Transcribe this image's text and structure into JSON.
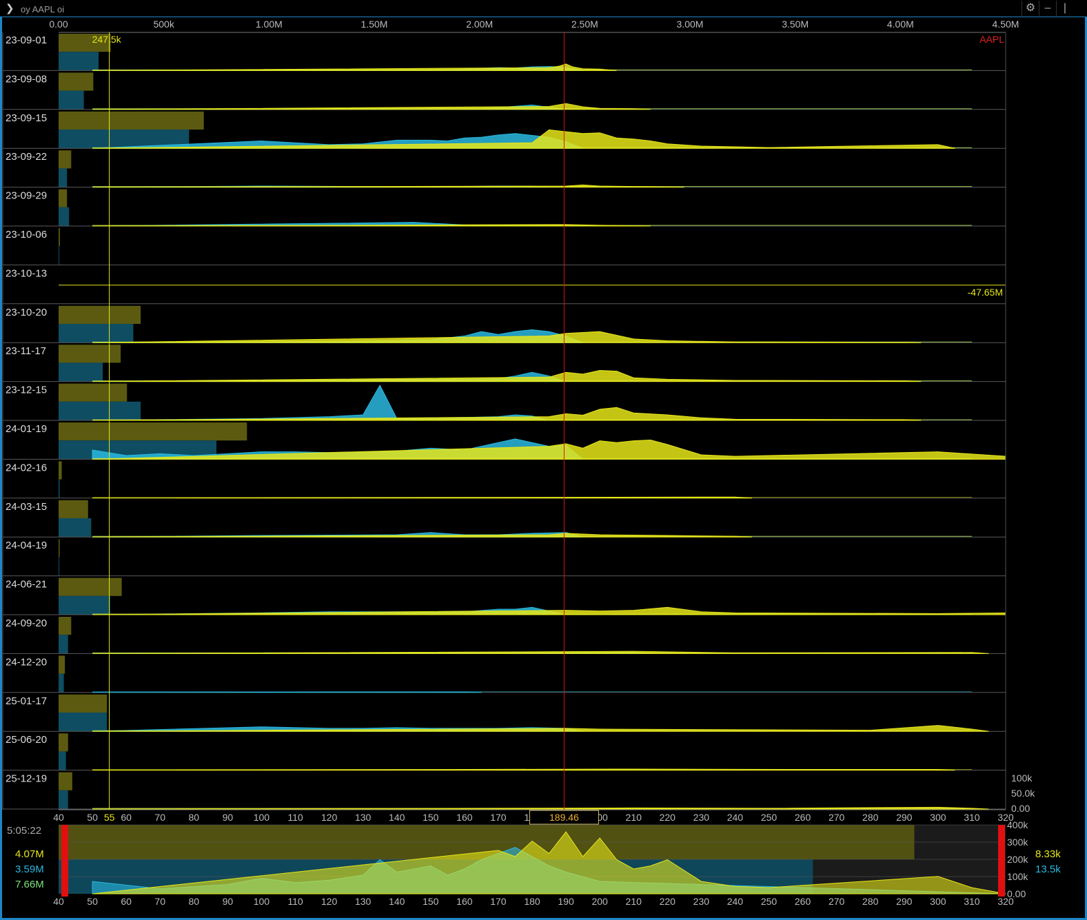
{
  "command": {
    "text": "oy AAPL oi"
  },
  "window_buttons": {
    "settings_icon": "gear-icon",
    "minimize": "–",
    "maximize": "|"
  },
  "colors": {
    "call": "#e6e619",
    "put": "#2ab9e0",
    "call_bar": "#5b5a10",
    "put_bar": "#0e4d62",
    "price_line": "#cc1a1a",
    "frame": "#1f86c7"
  },
  "chart_data": {
    "type": "area",
    "symbol": "AAPL",
    "title": "",
    "top_axis": {
      "ticks": [
        "0.00",
        "500k",
        "1.00M",
        "1.50M",
        "2.00M",
        "2.50M",
        "3.00M",
        "3.50M",
        "4.00M",
        "4.50M"
      ],
      "range": [
        0,
        4500000
      ]
    },
    "strike_axis": {
      "ticks": [
        40,
        50,
        60,
        70,
        80,
        90,
        100,
        110,
        120,
        130,
        140,
        150,
        160,
        170,
        180,
        190,
        200,
        210,
        220,
        230,
        240,
        250,
        260,
        270,
        280,
        290,
        300,
        310,
        320
      ],
      "range": [
        40,
        320
      ]
    },
    "right_axis": {
      "ticks": [
        "100k",
        "50.0k",
        "0.00"
      ]
    },
    "marker_strike": 55,
    "marker_value_label": "247.5k",
    "current_price": "189.46",
    "divider_label": "-47.65M",
    "expiries": [
      {
        "label": "23-09-01",
        "call_total": 247500,
        "put_total": 190000,
        "calls": [
          [
            185,
            0.08
          ],
          [
            188,
            0.12
          ],
          [
            190,
            0.18
          ],
          [
            192,
            0.1
          ],
          [
            195,
            0.05
          ],
          [
            200,
            0.04
          ]
        ],
        "puts": [
          [
            155,
            0.02
          ],
          [
            160,
            0.04
          ],
          [
            165,
            0.06
          ],
          [
            170,
            0.08
          ],
          [
            175,
            0.07
          ],
          [
            180,
            0.1
          ],
          [
            185,
            0.11
          ],
          [
            190,
            0.09
          ]
        ]
      },
      {
        "label": "23-09-08",
        "call_total": 165000,
        "put_total": 120000,
        "calls": [
          [
            185,
            0.08
          ],
          [
            190,
            0.16
          ],
          [
            195,
            0.07
          ],
          [
            200,
            0.03
          ],
          [
            210,
            0.02
          ]
        ],
        "puts": [
          [
            165,
            0.03
          ],
          [
            170,
            0.05
          ],
          [
            180,
            0.12
          ],
          [
            185,
            0.06
          ]
        ]
      },
      {
        "label": "23-09-15",
        "call_total": 690000,
        "put_total": 620000,
        "calls": [
          [
            180,
            0.15
          ],
          [
            185,
            0.5
          ],
          [
            190,
            0.45
          ],
          [
            195,
            0.4
          ],
          [
            200,
            0.42
          ],
          [
            205,
            0.28
          ],
          [
            210,
            0.25
          ],
          [
            215,
            0.2
          ],
          [
            220,
            0.12
          ],
          [
            230,
            0.06
          ],
          [
            240,
            0.04
          ],
          [
            250,
            0.02
          ],
          [
            300,
            0.1
          ]
        ],
        "puts": [
          [
            100,
            0.2
          ],
          [
            120,
            0.1
          ],
          [
            130,
            0.12
          ],
          [
            140,
            0.22
          ],
          [
            150,
            0.22
          ],
          [
            155,
            0.2
          ],
          [
            160,
            0.28
          ],
          [
            165,
            0.3
          ],
          [
            170,
            0.36
          ],
          [
            175,
            0.4
          ],
          [
            180,
            0.35
          ],
          [
            185,
            0.3
          ],
          [
            190,
            0.18
          ]
        ]
      },
      {
        "label": "23-09-22",
        "call_total": 60000,
        "put_total": 40000,
        "calls": [
          [
            190,
            0.03
          ],
          [
            195,
            0.06
          ],
          [
            200,
            0.03
          ],
          [
            220,
            0.01
          ]
        ],
        "puts": [
          [
            100,
            0.03
          ],
          [
            150,
            0.01
          ],
          [
            170,
            0.03
          ],
          [
            180,
            0.03
          ]
        ]
      },
      {
        "label": "23-09-29",
        "call_total": 40000,
        "put_total": 50000,
        "calls": [
          [
            190,
            0.04
          ],
          [
            195,
            0.03
          ],
          [
            200,
            0.02
          ],
          [
            210,
            0.01
          ]
        ],
        "puts": [
          [
            145,
            0.1
          ],
          [
            160,
            0.03
          ],
          [
            170,
            0.03
          ],
          [
            180,
            0.02
          ]
        ]
      },
      {
        "label": "23-10-06",
        "call_total": 6000,
        "put_total": 3000,
        "calls": [],
        "puts": []
      },
      {
        "label": "23-10-13",
        "call_total": 0,
        "put_total": 0,
        "calls": [],
        "puts": []
      },
      {
        "label": "23-10-20",
        "call_total": 390000,
        "put_total": 355000,
        "calls": [
          [
            185,
            0.18
          ],
          [
            190,
            0.25
          ],
          [
            200,
            0.3
          ],
          [
            210,
            0.1
          ],
          [
            220,
            0.05
          ],
          [
            240,
            0.02
          ],
          [
            290,
            0.01
          ]
        ],
        "puts": [
          [
            130,
            0.04
          ],
          [
            150,
            0.08
          ],
          [
            160,
            0.18
          ],
          [
            165,
            0.3
          ],
          [
            170,
            0.22
          ],
          [
            175,
            0.3
          ],
          [
            180,
            0.35
          ],
          [
            185,
            0.3
          ],
          [
            190,
            0.18
          ]
        ]
      },
      {
        "label": "23-11-17",
        "call_total": 295000,
        "put_total": 210000,
        "calls": [
          [
            185,
            0.12
          ],
          [
            190,
            0.25
          ],
          [
            195,
            0.2
          ],
          [
            200,
            0.3
          ],
          [
            205,
            0.28
          ],
          [
            210,
            0.1
          ],
          [
            220,
            0.06
          ],
          [
            240,
            0.03
          ],
          [
            290,
            0.02
          ]
        ],
        "puts": [
          [
            130,
            0.05
          ],
          [
            140,
            0.06
          ],
          [
            160,
            0.06
          ],
          [
            170,
            0.08
          ],
          [
            175,
            0.15
          ],
          [
            180,
            0.25
          ],
          [
            185,
            0.15
          ]
        ]
      },
      {
        "label": "23-12-15",
        "call_total": 325000,
        "put_total": 390000,
        "calls": [
          [
            185,
            0.1
          ],
          [
            190,
            0.18
          ],
          [
            195,
            0.14
          ],
          [
            200,
            0.3
          ],
          [
            205,
            0.35
          ],
          [
            210,
            0.2
          ],
          [
            220,
            0.15
          ],
          [
            230,
            0.07
          ],
          [
            240,
            0.03
          ],
          [
            290,
            0.02
          ]
        ],
        "puts": [
          [
            100,
            0.05
          ],
          [
            120,
            0.1
          ],
          [
            130,
            0.15
          ],
          [
            135,
            0.95
          ],
          [
            140,
            0.05
          ],
          [
            150,
            0.07
          ],
          [
            160,
            0.08
          ],
          [
            170,
            0.1
          ],
          [
            175,
            0.15
          ],
          [
            180,
            0.12
          ]
        ]
      },
      {
        "label": "24-01-19",
        "call_total": 895000,
        "put_total": 750000,
        "calls": [
          [
            185,
            0.35
          ],
          [
            190,
            0.42
          ],
          [
            195,
            0.3
          ],
          [
            200,
            0.5
          ],
          [
            205,
            0.45
          ],
          [
            210,
            0.5
          ],
          [
            215,
            0.52
          ],
          [
            220,
            0.4
          ],
          [
            230,
            0.12
          ],
          [
            240,
            0.08
          ],
          [
            250,
            0.1
          ],
          [
            300,
            0.2
          ],
          [
            320,
            0.08
          ]
        ],
        "puts": [
          [
            50,
            0.25
          ],
          [
            60,
            0.1
          ],
          [
            70,
            0.15
          ],
          [
            80,
            0.1
          ],
          [
            90,
            0.15
          ],
          [
            100,
            0.2
          ],
          [
            110,
            0.2
          ],
          [
            120,
            0.18
          ],
          [
            130,
            0.2
          ],
          [
            140,
            0.22
          ],
          [
            150,
            0.3
          ],
          [
            160,
            0.25
          ],
          [
            170,
            0.45
          ],
          [
            175,
            0.55
          ],
          [
            180,
            0.45
          ],
          [
            185,
            0.35
          ],
          [
            190,
            0.38
          ]
        ]
      },
      {
        "label": "24-02-16",
        "call_total": 15000,
        "put_total": 5000,
        "calls": [
          [
            240,
            0.03
          ]
        ],
        "puts": []
      },
      {
        "label": "24-03-15",
        "call_total": 140000,
        "put_total": 155000,
        "calls": [
          [
            185,
            0.06
          ],
          [
            190,
            0.1
          ],
          [
            200,
            0.06
          ],
          [
            210,
            0.05
          ],
          [
            220,
            0.04
          ],
          [
            240,
            0.02
          ]
        ],
        "puts": [
          [
            100,
            0.04
          ],
          [
            140,
            0.06
          ],
          [
            150,
            0.12
          ],
          [
            160,
            0.06
          ],
          [
            170,
            0.06
          ],
          [
            180,
            0.1
          ],
          [
            190,
            0.12
          ]
        ]
      },
      {
        "label": "24-04-19",
        "call_total": 5000,
        "put_total": 2000,
        "calls": [],
        "puts": []
      },
      {
        "label": "24-06-21",
        "call_total": 300000,
        "put_total": 245000,
        "calls": [
          [
            190,
            0.12
          ],
          [
            200,
            0.1
          ],
          [
            210,
            0.12
          ],
          [
            220,
            0.2
          ],
          [
            230,
            0.08
          ],
          [
            240,
            0.05
          ],
          [
            300,
            0.03
          ],
          [
            320,
            0.05
          ]
        ],
        "puts": [
          [
            100,
            0.05
          ],
          [
            120,
            0.08
          ],
          [
            130,
            0.08
          ],
          [
            150,
            0.08
          ],
          [
            160,
            0.08
          ],
          [
            170,
            0.15
          ],
          [
            175,
            0.15
          ],
          [
            180,
            0.2
          ],
          [
            185,
            0.1
          ]
        ]
      },
      {
        "label": "24-09-20",
        "call_total": 60000,
        "put_total": 45000,
        "calls": [
          [
            210,
            0.06
          ],
          [
            240,
            0.02
          ],
          [
            310,
            0.03
          ]
        ],
        "puts": [
          [
            180,
            0.02
          ],
          [
            210,
            0.04
          ]
        ]
      },
      {
        "label": "24-12-20",
        "call_total": 30000,
        "put_total": 25000,
        "calls": [],
        "puts": [
          [
            160,
            0.01
          ]
        ]
      },
      {
        "label": "25-01-17",
        "call_total": 230000,
        "put_total": 230000,
        "calls": [
          [
            190,
            0.08
          ],
          [
            200,
            0.06
          ],
          [
            250,
            0.04
          ],
          [
            280,
            0.03
          ],
          [
            300,
            0.16
          ],
          [
            310,
            0.06
          ]
        ],
        "puts": [
          [
            100,
            0.12
          ],
          [
            120,
            0.08
          ],
          [
            130,
            0.08
          ],
          [
            140,
            0.1
          ],
          [
            150,
            0.08
          ],
          [
            170,
            0.08
          ],
          [
            180,
            0.1
          ],
          [
            190,
            0.08
          ]
        ]
      },
      {
        "label": "25-06-20",
        "call_total": 45000,
        "put_total": 35000,
        "calls": [
          [
            210,
            0.03
          ],
          [
            260,
            0.02
          ],
          [
            300,
            0.02
          ]
        ],
        "puts": []
      },
      {
        "label": "25-12-19",
        "call_total": 65000,
        "put_total": 45000,
        "calls": [
          [
            210,
            0.03
          ],
          [
            250,
            0.02
          ],
          [
            300,
            0.05
          ],
          [
            310,
            0.02
          ]
        ],
        "puts": [
          [
            160,
            0.01
          ]
        ]
      }
    ],
    "bottom_panel": {
      "time": "5:05:22",
      "call_total": "4.07M",
      "put_total": "3.59M",
      "combined_total": "7.66M",
      "right_ticks": [
        "400k",
        "300k",
        "200k",
        "100k",
        "0.00"
      ],
      "right_call_value": "8.33k",
      "right_put_value": "13.5k",
      "calls": [
        [
          170,
          0.7
        ],
        [
          175,
          0.6
        ],
        [
          180,
          0.85
        ],
        [
          185,
          0.65
        ],
        [
          190,
          1.0
        ],
        [
          195,
          0.6
        ],
        [
          200,
          0.9
        ],
        [
          205,
          0.55
        ],
        [
          210,
          0.4
        ],
        [
          215,
          0.45
        ],
        [
          220,
          0.55
        ],
        [
          230,
          0.2
        ],
        [
          240,
          0.12
        ],
        [
          250,
          0.1
        ],
        [
          300,
          0.28
        ],
        [
          310,
          0.1
        ]
      ],
      "puts": [
        [
          50,
          0.2
        ],
        [
          70,
          0.08
        ],
        [
          90,
          0.15
        ],
        [
          100,
          0.25
        ],
        [
          110,
          0.18
        ],
        [
          120,
          0.22
        ],
        [
          130,
          0.3
        ],
        [
          135,
          0.55
        ],
        [
          140,
          0.35
        ],
        [
          150,
          0.45
        ],
        [
          155,
          0.3
        ],
        [
          160,
          0.4
        ],
        [
          165,
          0.55
        ],
        [
          170,
          0.65
        ],
        [
          175,
          0.75
        ],
        [
          180,
          0.6
        ],
        [
          185,
          0.45
        ],
        [
          190,
          0.35
        ],
        [
          200,
          0.2
        ]
      ]
    }
  }
}
